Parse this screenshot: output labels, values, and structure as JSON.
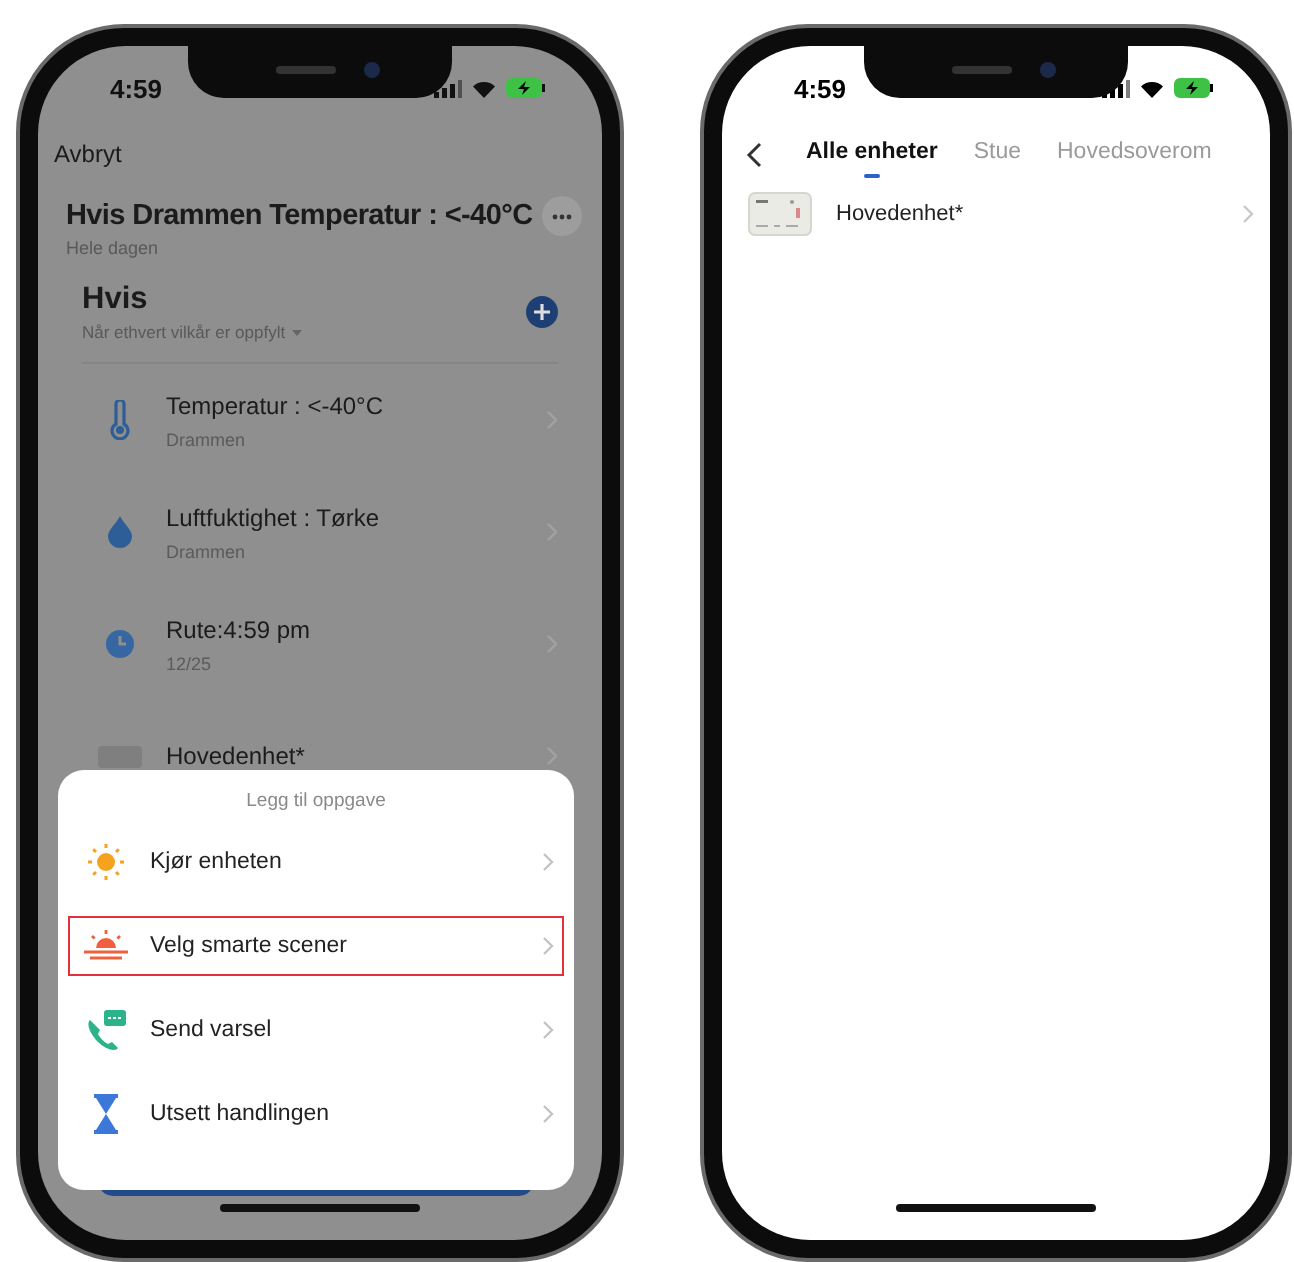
{
  "left_screen": {
    "status_bar": {
      "time": "4:59"
    },
    "cancel": "Avbryt",
    "title": "Hvis Drammen Temperatur : <-40°C",
    "subtitle": "Hele dagen",
    "section": {
      "title": "Hvis",
      "condition": "Når ethvert vilkår er oppfylt"
    },
    "conditions": [
      {
        "kind": "temperature",
        "title": "Temperatur : <-40°C",
        "subtitle": "Drammen"
      },
      {
        "kind": "humidity",
        "title": "Luftfuktighet : Tørke",
        "subtitle": "Drammen"
      },
      {
        "kind": "schedule",
        "title": "Rute:4:59 pm",
        "subtitle": "12/25"
      },
      {
        "kind": "device",
        "title": "Hovedenhet*"
      }
    ],
    "sheet": {
      "title": "Legg til oppgave",
      "items": [
        {
          "kind": "device",
          "label": "Kjør enheten",
          "selected": false
        },
        {
          "kind": "scene",
          "label": "Velg smarte scener",
          "selected": true
        },
        {
          "kind": "notify",
          "label": "Send varsel",
          "selected": false
        },
        {
          "kind": "delay",
          "label": "Utsett handlingen",
          "selected": false
        }
      ]
    }
  },
  "right_screen": {
    "status_bar": {
      "time": "4:59"
    },
    "tabs": [
      {
        "label": "Alle enheter",
        "selected": true
      },
      {
        "label": "Stue",
        "selected": false
      },
      {
        "label": "Hovedsoverom",
        "selected": false
      }
    ],
    "devices": [
      {
        "name": "Hovedenhet*"
      }
    ]
  }
}
